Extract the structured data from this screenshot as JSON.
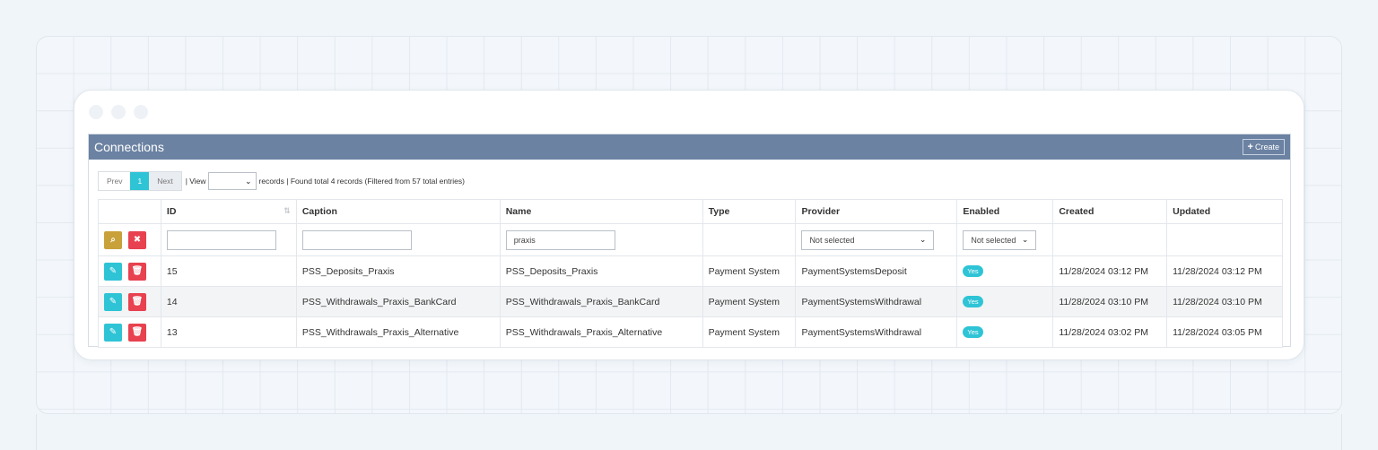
{
  "panel": {
    "title": "Connections",
    "create_label": "Create"
  },
  "toolbar": {
    "prev": "Prev",
    "page": "1",
    "next": "Next",
    "view": "| View",
    "records": "records | Found total 4 records (Filtered from 57 total entries)"
  },
  "columns": [
    "",
    "ID",
    "Caption",
    "Name",
    "Type",
    "Provider",
    "Enabled",
    "Created",
    "Updated"
  ],
  "filters": {
    "id": "",
    "caption": "",
    "name": "praxis",
    "provider": "Not selected",
    "enabled": "Not selected"
  },
  "rows": [
    {
      "id": "15",
      "caption": "PSS_Deposits_Praxis",
      "name": "PSS_Deposits_Praxis",
      "type": "Payment System",
      "provider": "PaymentSystemsDeposit",
      "enabled": "Yes",
      "created": "11/28/2024 03:12 PM",
      "updated": "11/28/2024 03:12 PM"
    },
    {
      "id": "14",
      "caption": "PSS_Withdrawals_Praxis_BankCard",
      "name": "PSS_Withdrawals_Praxis_BankCard",
      "type": "Payment System",
      "provider": "PaymentSystemsWithdrawal",
      "enabled": "Yes",
      "created": "11/28/2024 03:10 PM",
      "updated": "11/28/2024 03:10 PM"
    },
    {
      "id": "13",
      "caption": "PSS_Withdrawals_Praxis_Alternative",
      "name": "PSS_Withdrawals_Praxis_Alternative",
      "type": "Payment System",
      "provider": "PaymentSystemsWithdrawal",
      "enabled": "Yes",
      "created": "11/28/2024 03:02 PM",
      "updated": "11/28/2024 03:05 PM"
    }
  ],
  "colors": {
    "header": "#6b82a2",
    "accent": "#2ec4d6",
    "danger": "#e8414f",
    "search": "#c9a13a"
  }
}
